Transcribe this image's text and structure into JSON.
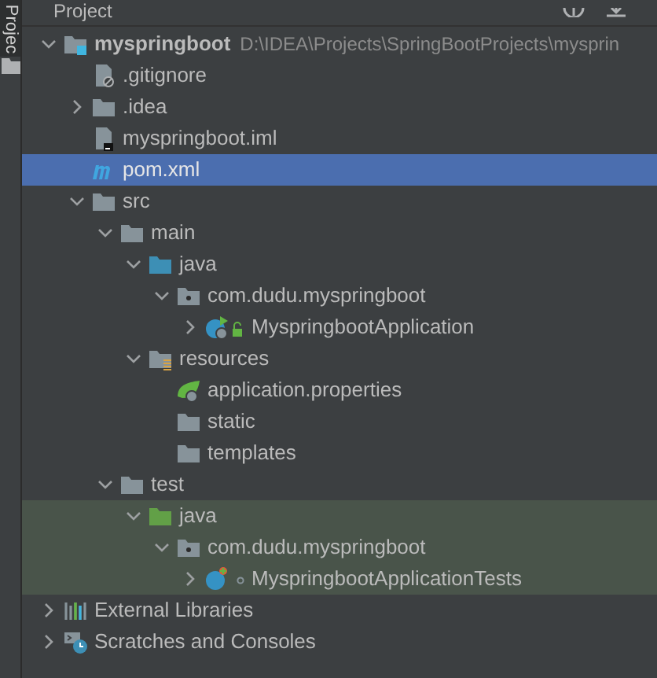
{
  "sidebar": {
    "tab": "Projec"
  },
  "header": {
    "title": "Project"
  },
  "tree": [
    {
      "label": "myspringboot",
      "path": "D:\\IDEA\\Projects\\SpringBootProjects\\mysprin",
      "kind": "module",
      "expanded": true,
      "selected": false,
      "highlighted": false,
      "children": [
        {
          "label": ".gitignore",
          "kind": "ignore-file",
          "selected": false,
          "highlighted": false
        },
        {
          "label": ".idea",
          "kind": "folder",
          "expanded": false,
          "selected": false,
          "highlighted": false
        },
        {
          "label": "myspringboot.iml",
          "kind": "iml-file",
          "selected": false,
          "highlighted": false
        },
        {
          "label": "pom.xml",
          "kind": "maven",
          "selected": true,
          "highlighted": false
        },
        {
          "label": "src",
          "kind": "folder",
          "expanded": true,
          "selected": false,
          "highlighted": false,
          "children": [
            {
              "label": "main",
              "kind": "folder",
              "expanded": true,
              "selected": false,
              "highlighted": false,
              "children": [
                {
                  "label": "java",
                  "kind": "source-folder",
                  "expanded": true,
                  "selected": false,
                  "highlighted": false,
                  "children": [
                    {
                      "label": "com.dudu.myspringboot",
                      "kind": "package",
                      "expanded": true,
                      "selected": false,
                      "highlighted": false,
                      "children": [
                        {
                          "label": "MyspringbootApplication",
                          "kind": "spring-class",
                          "expanded": false,
                          "selected": false,
                          "highlighted": false
                        }
                      ]
                    }
                  ]
                },
                {
                  "label": "resources",
                  "kind": "resources-folder",
                  "expanded": true,
                  "selected": false,
                  "highlighted": false,
                  "children": [
                    {
                      "label": "application.properties",
                      "kind": "spring-properties",
                      "selected": false,
                      "highlighted": false
                    },
                    {
                      "label": "static",
                      "kind": "folder",
                      "selected": false,
                      "highlighted": false
                    },
                    {
                      "label": "templates",
                      "kind": "folder",
                      "selected": false,
                      "highlighted": false
                    }
                  ]
                }
              ]
            },
            {
              "label": "test",
              "kind": "folder",
              "expanded": true,
              "selected": false,
              "highlighted": false,
              "children": [
                {
                  "label": "java",
                  "kind": "test-folder",
                  "expanded": true,
                  "selected": false,
                  "highlighted": true,
                  "children": [
                    {
                      "label": "com.dudu.myspringboot",
                      "kind": "package",
                      "expanded": true,
                      "selected": false,
                      "highlighted": true,
                      "children": [
                        {
                          "label": "MyspringbootApplicationTests",
                          "kind": "test-class",
                          "expanded": false,
                          "selected": false,
                          "highlighted": true
                        }
                      ]
                    }
                  ]
                }
              ]
            }
          ]
        }
      ]
    },
    {
      "label": "External Libraries",
      "kind": "libraries",
      "expanded": false,
      "selected": false,
      "highlighted": false
    },
    {
      "label": "Scratches and Consoles",
      "kind": "scratches",
      "expanded": false,
      "selected": false,
      "highlighted": false
    }
  ]
}
